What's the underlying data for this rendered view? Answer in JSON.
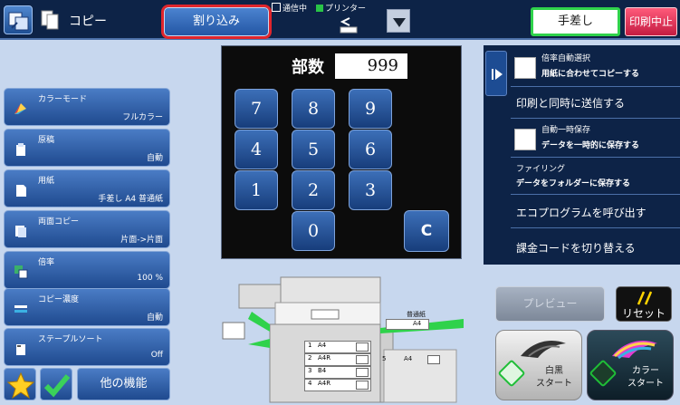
{
  "header": {
    "mode_title": "コピー",
    "interrupt_label": "割り込み",
    "status_comm": "通信中",
    "status_printer": "プリンター",
    "manual_feed_label": "手差し",
    "stop_print_label": "印刷中止"
  },
  "settings": [
    {
      "label": "カラーモード",
      "value": "フルカラー"
    },
    {
      "label": "原稿",
      "value": "自動"
    },
    {
      "label": "用紙",
      "value": "手差し A4 普通紙"
    },
    {
      "label": "両面コピー",
      "value": "片面->片面"
    },
    {
      "label": "倍率",
      "value": "100 %"
    },
    {
      "label": "コピー濃度",
      "value": "自動"
    },
    {
      "label": "ステープルソート",
      "value": "Off"
    }
  ],
  "bottom": {
    "other_functions_label": "他の機能"
  },
  "keypad": {
    "copies_label": "部数",
    "copies_value": "999",
    "keys": [
      "7",
      "8",
      "9",
      "4",
      "5",
      "6",
      "1",
      "2",
      "3",
      "0"
    ],
    "clear_label": "C"
  },
  "right_panel": {
    "auto_ratio_title": "倍率自動選択",
    "auto_ratio_sub": "用紙に合わせてコピーする",
    "send_while_print": "印刷と同時に送信する",
    "auto_save_title": "自動一時保存",
    "auto_save_sub": "データを一時的に保存する",
    "filing_title": "ファイリング",
    "filing_sub": "データをフォルダーに保存する",
    "eco_program": "エコプログラムを呼び出す",
    "billing_code": "課金コードを切り替える"
  },
  "machine": {
    "paper_type": "普通紙",
    "manual_paper_size": "A4",
    "trays": [
      {
        "num": "1",
        "size": "A4"
      },
      {
        "num": "2",
        "size": "A4R"
      },
      {
        "num": "3",
        "size": "B4"
      },
      {
        "num": "4",
        "size": "A4R"
      }
    ],
    "lct_num": "5",
    "lct_size": "A4"
  },
  "actions": {
    "preview_label": "プレビュー",
    "reset_label": "リセット",
    "bw_start_line1": "白黒",
    "bw_start_line2": "スタート",
    "color_start_line1": "カラー",
    "color_start_line2": "スタート"
  }
}
